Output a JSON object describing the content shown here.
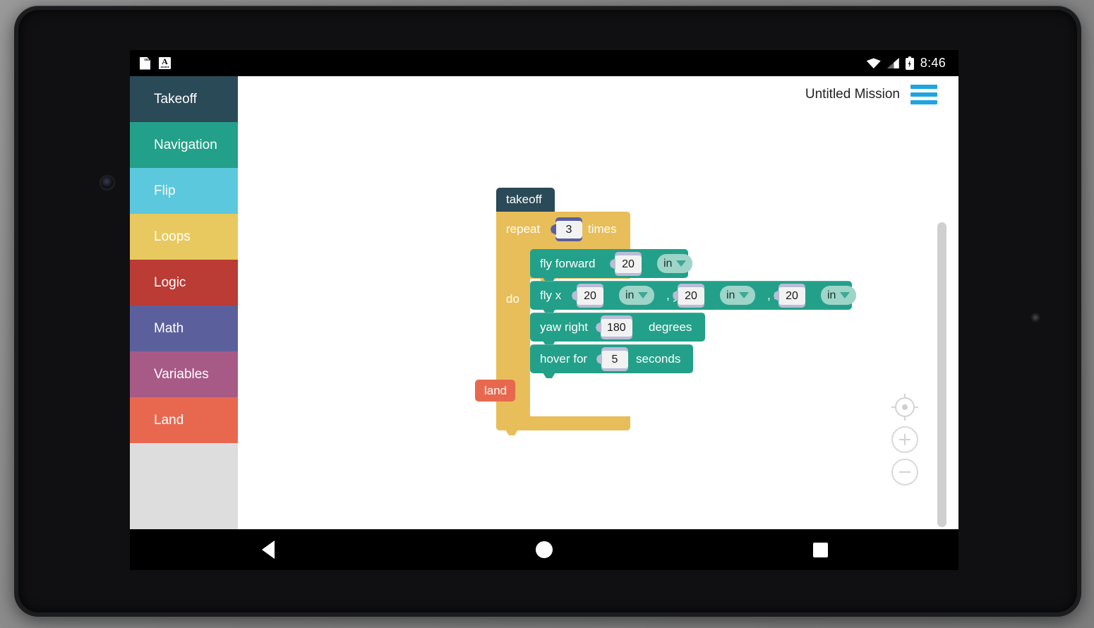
{
  "device": {
    "camera_icon": "front-camera",
    "led_icon": "sensor-led"
  },
  "statusbar": {
    "left_icons": [
      {
        "name": "sd-card-icon",
        "glyph": "sd-card"
      },
      {
        "name": "keyboard-language-icon",
        "glyph": "A"
      }
    ],
    "right_icons": [
      {
        "name": "wifi-icon",
        "glyph": "wifi-full"
      },
      {
        "name": "cellular-signal-icon",
        "glyph": "signal-2-bars"
      },
      {
        "name": "battery-charging-icon",
        "glyph": "battery-charging"
      }
    ],
    "clock": "8:46",
    "keyboard_letter": "A"
  },
  "sidebar": {
    "categories": [
      {
        "label": "Takeoff",
        "color": "#2b4a57"
      },
      {
        "label": "Navigation",
        "color": "#23a089"
      },
      {
        "label": "Flip",
        "color": "#5cc8dd"
      },
      {
        "label": "Loops",
        "color": "#e8c95f"
      },
      {
        "label": "Logic",
        "color": "#bb3b35"
      },
      {
        "label": "Math",
        "color": "#5b5f9c"
      },
      {
        "label": "Variables",
        "color": "#a85a87"
      },
      {
        "label": "Land",
        "color": "#e8684f"
      }
    ],
    "empty_area_color": "#dddddd"
  },
  "header": {
    "mission_title": "Untitled Mission",
    "menu_icon": "hamburger-menu",
    "menu_color": "#1ea5e0"
  },
  "workspace": {
    "background": "#ffffff",
    "scrollbar": {
      "name": "vertical-scrollbar"
    },
    "controls": [
      {
        "name": "center-workspace-button",
        "icon": "crosshair-target-icon"
      },
      {
        "name": "zoom-in-button",
        "icon": "plus-circle-icon",
        "label": "+"
      },
      {
        "name": "zoom-out-button",
        "icon": "minus-circle-icon",
        "label": "−"
      }
    ],
    "trash": {
      "name": "trash-can",
      "icon": "trash-icon"
    }
  },
  "program": {
    "takeoff": {
      "label": "takeoff",
      "color": "#2b4a57"
    },
    "repeat": {
      "label_repeat": "repeat",
      "count": "3",
      "label_times": "times",
      "label_do": "do",
      "color": "#e8be5a",
      "socket_color": "#5b5f9c"
    },
    "statements": [
      {
        "name": "fly-forward-block",
        "label": "fly forward",
        "fields": [
          {
            "type": "number",
            "value": "20"
          },
          {
            "type": "dropdown",
            "value": "in"
          }
        ]
      },
      {
        "name": "fly-xyz-block",
        "label": "fly x",
        "label_y": ", y",
        "label_z": ", z",
        "fields": [
          {
            "type": "number",
            "value": "20"
          },
          {
            "type": "dropdown",
            "value": "in"
          },
          {
            "type": "number",
            "value": "20"
          },
          {
            "type": "dropdown",
            "value": "in"
          },
          {
            "type": "number",
            "value": "20"
          },
          {
            "type": "dropdown",
            "value": "in"
          }
        ]
      },
      {
        "name": "yaw-right-block",
        "label": "yaw right",
        "suffix": "degrees",
        "fields": [
          {
            "type": "number",
            "value": "180"
          }
        ]
      },
      {
        "name": "hover-for-block",
        "label": "hover for",
        "suffix": "seconds",
        "fields": [
          {
            "type": "number",
            "value": "5"
          }
        ]
      }
    ],
    "land": {
      "label": "land",
      "color": "#e8684f"
    },
    "block_color_teal": "#23a089",
    "dropdown_color": "#9fd4c9"
  },
  "navbar": {
    "buttons": [
      {
        "name": "nav-back-button",
        "icon": "triangle-back-icon"
      },
      {
        "name": "nav-home-button",
        "icon": "circle-home-icon"
      },
      {
        "name": "nav-recents-button",
        "icon": "square-recents-icon"
      }
    ]
  }
}
